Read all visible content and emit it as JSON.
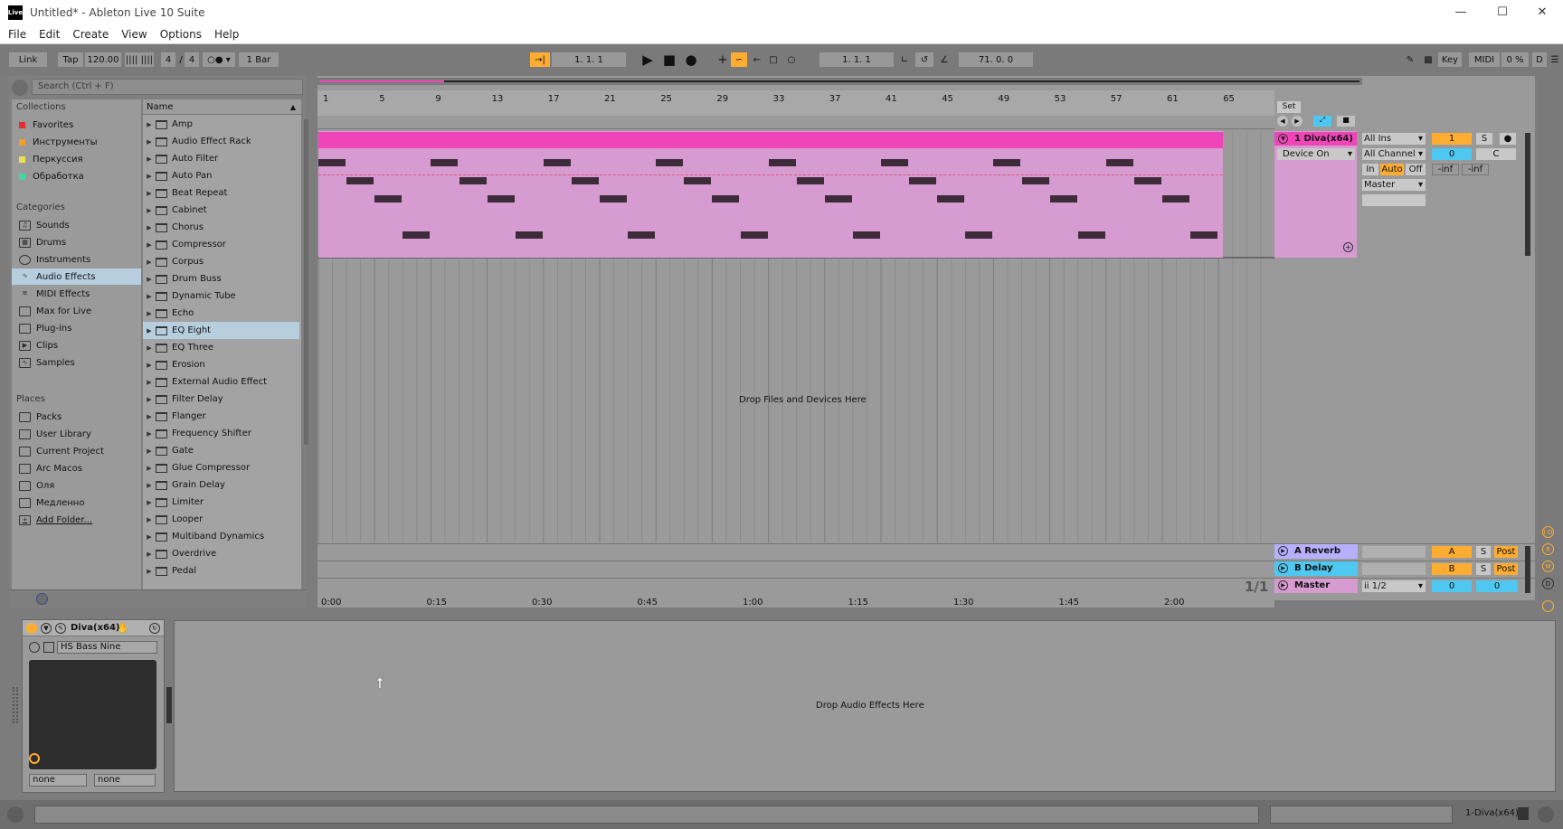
{
  "window": {
    "title": "Untitled* - Ableton Live 10 Suite",
    "logo_text": "Live"
  },
  "menu": [
    "File",
    "Edit",
    "Create",
    "View",
    "Options",
    "Help"
  ],
  "control_bar": {
    "link": "Link",
    "tap": "Tap",
    "tempo": "120.00",
    "sig_num": "4",
    "sig_den": "4",
    "quantize": "1 Bar",
    "position": "1.   1.   1",
    "loop_start": "1.   1.   1",
    "loop_length": "71.   0.   0",
    "key": "Key",
    "midi": "MIDI",
    "cpu": "0 %",
    "d": "D"
  },
  "browser": {
    "search_placeholder": "Search (Ctrl + F)",
    "collections_label": "Collections",
    "collections": [
      {
        "label": "Favorites",
        "color": "#e23030"
      },
      {
        "label": "Инструменты",
        "color": "#f0a028"
      },
      {
        "label": "Перкуссия",
        "color": "#f0e050"
      },
      {
        "label": "Обработка",
        "color": "#40d8a0"
      }
    ],
    "categories_label": "Categories",
    "categories": [
      {
        "label": "Sounds",
        "icon": "note-icon"
      },
      {
        "label": "Drums",
        "icon": "grid-icon"
      },
      {
        "label": "Instruments",
        "icon": "clock-icon"
      },
      {
        "label": "Audio Effects",
        "icon": "wave-icon"
      },
      {
        "label": "MIDI Effects",
        "icon": "midi-icon"
      },
      {
        "label": "Max for Live",
        "icon": "max-icon"
      },
      {
        "label": "Plug-ins",
        "icon": "plugin-icon"
      },
      {
        "label": "Clips",
        "icon": "clip-icon"
      },
      {
        "label": "Samples",
        "icon": "sample-icon"
      }
    ],
    "places_label": "Places",
    "places": [
      "Packs",
      "User Library",
      "Current Project",
      "Arc Macos",
      "Оля",
      "Медленно",
      "Add Folder..."
    ],
    "name_header": "Name",
    "items": [
      "Amp",
      "Audio Effect Rack",
      "Auto Filter",
      "Auto Pan",
      "Beat Repeat",
      "Cabinet",
      "Chorus",
      "Compressor",
      "Corpus",
      "Drum Buss",
      "Dynamic Tube",
      "Echo",
      "EQ Eight",
      "EQ Three",
      "Erosion",
      "External Audio Effect",
      "Filter Delay",
      "Flanger",
      "Frequency Shifter",
      "Gate",
      "Glue Compressor",
      "Grain Delay",
      "Limiter",
      "Looper",
      "Multiband Dynamics",
      "Overdrive",
      "Pedal"
    ]
  },
  "arrangement": {
    "bars": [
      "1",
      "5",
      "9",
      "13",
      "17",
      "21",
      "25",
      "29",
      "33",
      "37",
      "41",
      "45",
      "49",
      "53",
      "57",
      "61",
      "65"
    ],
    "set_label": "Set",
    "drop_files": "Drop Files and Devices Here",
    "time_labels": [
      "0:00",
      "0:15",
      "0:30",
      "0:45",
      "1:00",
      "1:15",
      "1:30",
      "1:45",
      "2:00"
    ],
    "zoom": "1/1"
  },
  "track": {
    "name": "1 Diva(x64)",
    "device_on": "Device On",
    "input": "All Ins",
    "channel": "All Channel",
    "in": "In",
    "auto": "Auto",
    "off": "Off",
    "output": "Master",
    "number": "1",
    "s": "S",
    "vol": "0",
    "pan": "C",
    "peak_l": "-inf",
    "peak_r": "-inf"
  },
  "returns": [
    {
      "name": "A Reverb",
      "letter": "A",
      "s": "S",
      "post": "Post",
      "color": "#b8b0ff"
    },
    {
      "name": "B Delay",
      "letter": "B",
      "s": "S",
      "post": "Post",
      "color": "#4ec8f0"
    }
  ],
  "master": {
    "name": "Master",
    "routing": "ii 1/2",
    "vol": "0",
    "pan": "0"
  },
  "device": {
    "name": "Diva(x64)",
    "preset": "HS Bass Nine",
    "param1": "none",
    "param2": "none"
  },
  "device_view": {
    "drop_text": "Drop Audio Effects Here"
  },
  "status": {
    "track": "1-Diva(x64)"
  }
}
